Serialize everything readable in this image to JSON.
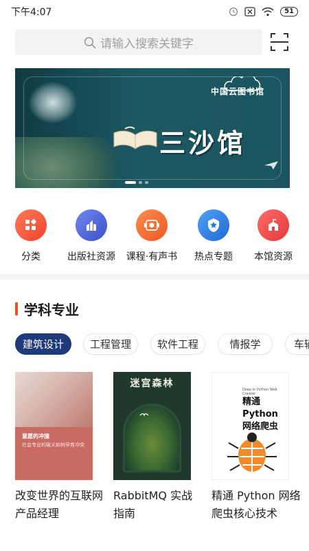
{
  "status_bar": {
    "time": "下午4:07",
    "battery": "51"
  },
  "search": {
    "placeholder": "请输入搜索关键字"
  },
  "banner": {
    "logo_text": "中国云图书馆",
    "title": "三沙馆",
    "active_slide": 1,
    "slide_count": 3
  },
  "menu": {
    "items": [
      {
        "label": "分类",
        "icon": "grid-icon",
        "color": "#f0533b"
      },
      {
        "label": "出版社资源",
        "icon": "building-icon",
        "color": "#4a62d6"
      },
      {
        "label": "课程·有声书",
        "icon": "audio-icon",
        "color": "#f26a3a"
      },
      {
        "label": "热点专题",
        "icon": "star-badge-icon",
        "color": "#2f7de1"
      },
      {
        "label": "本馆资源",
        "icon": "library-icon",
        "color": "#ef4a4a"
      }
    ]
  },
  "section": {
    "title": "学科专业"
  },
  "chips": {
    "items": [
      "建筑设计",
      "工程管理",
      "软件工程",
      "情报学",
      "车辆"
    ],
    "active_index": 0
  },
  "books": [
    {
      "title": "改变世界的互联网产品经理",
      "cover_text_1": "意愿的冲撞",
      "cover_text_2": "社会专业的破义如何孕育冲突"
    },
    {
      "title": "RabbitMQ 实战指南",
      "cover_text_1": "迷宫森林"
    },
    {
      "title": "精通 Python 网络爬虫核心技术",
      "cover_text_1": "精通Python\n网络爬虫",
      "cover_text_2": "Deep in Python Web Crawler"
    }
  ],
  "colors": {
    "accent": "#e2522b",
    "chip_active": "#1f3a7a"
  }
}
